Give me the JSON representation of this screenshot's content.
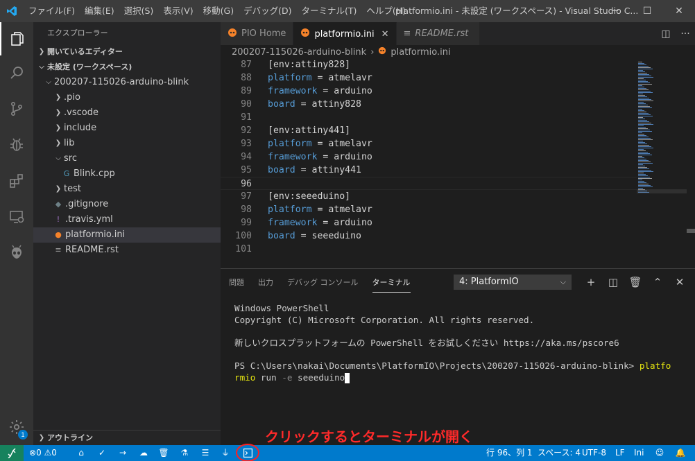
{
  "titlebar": {
    "menu": [
      "ファイル(F)",
      "編集(E)",
      "選択(S)",
      "表示(V)",
      "移動(G)",
      "デバッグ(D)",
      "ターミナル(T)",
      "ヘルプ(H)"
    ],
    "window_title": "platformio.ini - 未設定 (ワークスペース) - Visual Studio C...",
    "minimize": "─",
    "maximize": "☐",
    "close": "✕"
  },
  "sidebar": {
    "title": "エクスプローラー",
    "open_editors": "開いているエディター",
    "workspace": "未設定 (ワークスペース)",
    "project": "200207-115026-arduino-blink",
    "tree": [
      {
        "label": ".pio",
        "kind": "folder",
        "depth": 2,
        "expanded": false
      },
      {
        "label": ".vscode",
        "kind": "folder",
        "depth": 2,
        "expanded": false
      },
      {
        "label": "include",
        "kind": "folder",
        "depth": 2,
        "expanded": false
      },
      {
        "label": "lib",
        "kind": "folder",
        "depth": 2,
        "expanded": false
      },
      {
        "label": "src",
        "kind": "folder",
        "depth": 2,
        "expanded": true
      },
      {
        "label": "Blink.cpp",
        "kind": "cpp",
        "depth": 3
      },
      {
        "label": "test",
        "kind": "folder",
        "depth": 2,
        "expanded": false
      },
      {
        "label": ".gitignore",
        "kind": "git",
        "depth": 2
      },
      {
        "label": ".travis.yml",
        "kind": "yml",
        "depth": 2
      },
      {
        "label": "platformio.ini",
        "kind": "pio",
        "depth": 2,
        "selected": true
      },
      {
        "label": "README.rst",
        "kind": "rst",
        "depth": 2
      }
    ],
    "outline": "アウトライン",
    "settings_badge": "1"
  },
  "tabs": [
    {
      "label": "PIO Home",
      "active": false,
      "italic": false
    },
    {
      "label": "platformio.ini",
      "active": true,
      "italic": false
    },
    {
      "label": "README.rst",
      "active": false,
      "italic": true
    }
  ],
  "breadcrumb": {
    "folder": "200207-115026-arduino-blink",
    "file": "platformio.ini"
  },
  "editor": {
    "current_line": 96,
    "lines": [
      {
        "n": "87",
        "text": "[env:attiny828]"
      },
      {
        "n": "88",
        "key": "platform",
        "value": "atmelavr"
      },
      {
        "n": "89",
        "key": "framework",
        "value": "arduino"
      },
      {
        "n": "90",
        "key": "board",
        "value": "attiny828"
      },
      {
        "n": "91",
        "text": ""
      },
      {
        "n": "92",
        "text": "[env:attiny441]"
      },
      {
        "n": "93",
        "key": "platform",
        "value": "atmelavr"
      },
      {
        "n": "94",
        "key": "framework",
        "value": "arduino"
      },
      {
        "n": "95",
        "key": "board",
        "value": "attiny441"
      },
      {
        "n": "96",
        "text": ""
      },
      {
        "n": "97",
        "text": "[env:seeeduino]"
      },
      {
        "n": "98",
        "key": "platform",
        "value": "atmelavr"
      },
      {
        "n": "99",
        "key": "framework",
        "value": "arduino"
      },
      {
        "n": "100",
        "key": "board",
        "value": "seeeduino"
      },
      {
        "n": "101",
        "text": ""
      }
    ]
  },
  "panel": {
    "tabs": [
      "問題",
      "出力",
      "デバッグ コンソール",
      "ターミナル"
    ],
    "active_tab": "ターミナル",
    "terminal_select": "4: PlatformIO",
    "terminal": {
      "line1": "Windows PowerShell",
      "line2": "Copyright (C) Microsoft Corporation. All rights reserved.",
      "line3": "新しいクロスプラットフォームの PowerShell をお試しください https://aka.ms/pscore6",
      "prompt": "PS C:\\Users\\nakai\\Documents\\PlatformIO\\Projects\\200207-115026-arduino-blink> ",
      "cmd_a": "platfo",
      "cmd_b": "rmio",
      "cmd_rest": " run ",
      "cmd_flag": "-e",
      "cmd_arg": " seeeduino"
    }
  },
  "annotation": "クリックするとターミナルが開く",
  "statusbar": {
    "errors": "0",
    "warnings": "0",
    "position": "行 96、列 1",
    "spaces": "スペース: 4",
    "encoding": "UTF-8",
    "eol": "LF",
    "language": "Ini"
  },
  "colors": {
    "accent": "#007acc",
    "remote": "#16825d",
    "annotation": "#ff2a2a",
    "keyword": "#569cd6"
  }
}
